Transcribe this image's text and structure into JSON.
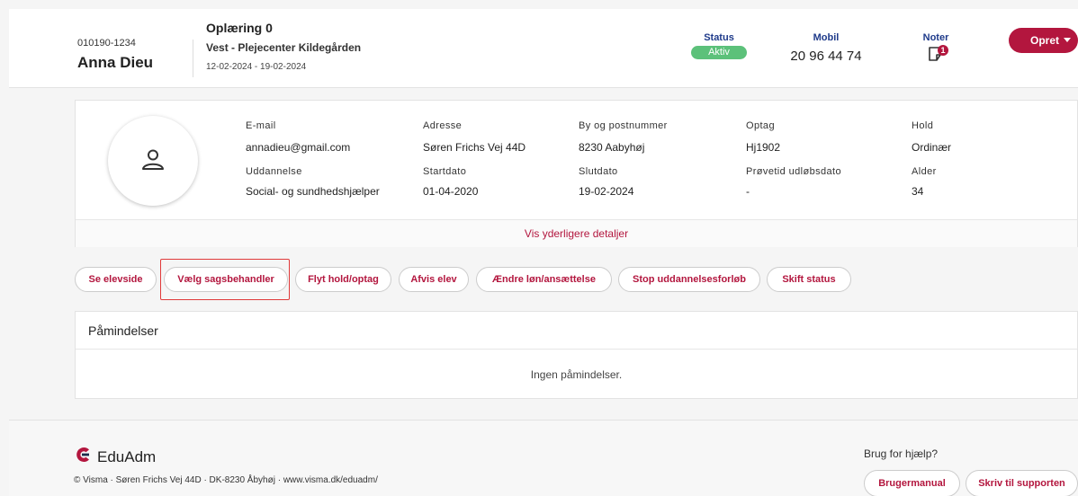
{
  "header": {
    "student_id": "010190-1234",
    "student_name": "Anna Dieu",
    "course_title": "Oplæring 0",
    "place": "Vest - Plejecenter Kildegården",
    "dates": "12-02-2024 - 19-02-2024",
    "status_label": "Status",
    "status_value": "Aktiv",
    "mobile_label": "Mobil",
    "mobile_value": "20 96 44 74",
    "notes_label": "Noter",
    "notes_count": "1",
    "create_button": "Opret"
  },
  "profile": {
    "email_label": "E-mail",
    "email_value": "annadieu@gmail.com",
    "address_label": "Adresse",
    "address_value": "Søren Frichs Vej 44D",
    "city_label": "By og postnummer",
    "city_value": "8230 Aabyhøj",
    "intake_label": "Optag",
    "intake_value": "Hj1902",
    "team_label": "Hold",
    "team_value": "Ordinær",
    "education_label": "Uddannelse",
    "education_value": "Social- og sundhedshjælper",
    "start_label": "Startdato",
    "start_value": "01-04-2020",
    "end_label": "Slutdato",
    "end_value": "19-02-2024",
    "probation_label": "Prøvetid udløbsdato",
    "probation_value": "-",
    "age_label": "Alder",
    "age_value": "34",
    "more_details_link": "Vis yderligere detaljer"
  },
  "actions": [
    "Se elevside",
    "Vælg sagsbehandler",
    "Flyt hold/optag",
    "Afvis elev",
    "Ændre løn/ansættelse",
    "Stop uddannelsesforløb",
    "Skift status"
  ],
  "reminders": {
    "title": "Påmindelser",
    "empty_text": "Ingen påmindelser."
  },
  "footer": {
    "logo_text": "EduAdm",
    "copyright": "© Visma · Søren Frichs Vej 44D · DK-8230 Åbyhøj · www.visma.dk/eduadm/",
    "help_text": "Brug for hjælp?",
    "manual_button": "Brugermanual",
    "support_button": "Skriv til supporten"
  },
  "colors": {
    "accent": "#b3163e",
    "status_active": "#5cc17a",
    "label_blue": "#1e3a8a"
  },
  "icons": {
    "avatar": "user-icon",
    "notes": "note-icon",
    "logo": "eduadm-logo"
  }
}
